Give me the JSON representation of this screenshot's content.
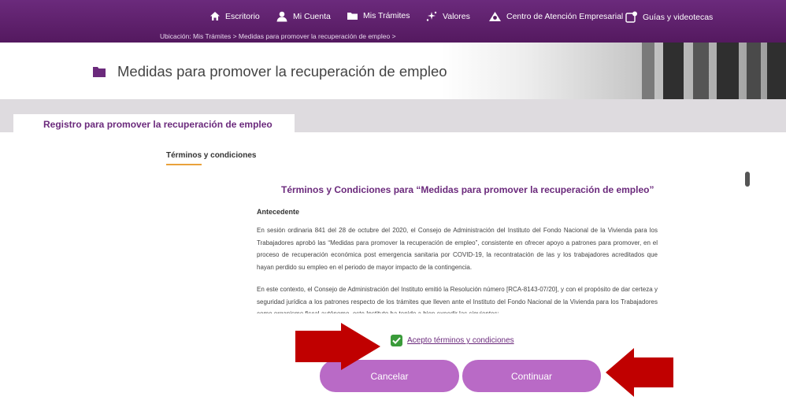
{
  "nav": {
    "items": [
      {
        "label": "Escritorio",
        "icon": "home-icon"
      },
      {
        "label": "Mi Cuenta",
        "icon": "user-icon"
      },
      {
        "label": "Mis Trámites",
        "icon": "folder-icon"
      },
      {
        "label": "Valores",
        "icon": "sparkle-icon"
      },
      {
        "label": "Centro de Atención Empresarial",
        "icon": "support-icon"
      },
      {
        "label": "Guías y videotecas",
        "icon": "guide-icon"
      }
    ],
    "breadcrumb": "Ubicación: Mis Trámites > Medidas para promover la recuperación de empleo >"
  },
  "banner": {
    "title": "Medidas para promover la recuperación de empleo"
  },
  "tabs": {
    "main": "Registro para promover la recuperación de empleo",
    "sub": "Términos y condiciones"
  },
  "terms": {
    "title": "Términos y Condiciones para “Medidas para promover la recuperación de empleo”",
    "heading": "Antecedente",
    "paragraph1": "En sesión ordinaria 841 del 28 de octubre del 2020, el Consejo de Administración del Instituto del Fondo Nacional de la Vivienda para los Trabajadores aprobó las “Medidas para promover la recuperación de empleo”, consistente en ofrecer apoyo a patrones para promover, en el proceso de recuperación económica post emergencia sanitaria por COVID-19, la recontratación de las y los trabajadores acreditados que hayan perdido su empleo en el periodo de mayor impacto de la contingencia.",
    "paragraph2": "En este contexto, el Consejo de Administración del Instituto emitió la Resolución número [RCA-8143-07/20], y con el propósito de dar certeza y seguridad jurídica a los patrones respecto de los trámites que lleven ante el Instituto del Fondo Nacional de la Vivienda para los Trabajadores como organismo fiscal autónomo, este Instituto ha tenido a bien expedir las siguientes:"
  },
  "accept": {
    "label": "Acepto términos y condiciones",
    "checked": true
  },
  "buttons": {
    "cancel": "Cancelar",
    "continue": "Continuar"
  },
  "colors": {
    "brand": "#6b2a7c",
    "button": "#b96ac6",
    "check": "#3a9b3a",
    "arrow": "#c00000"
  }
}
